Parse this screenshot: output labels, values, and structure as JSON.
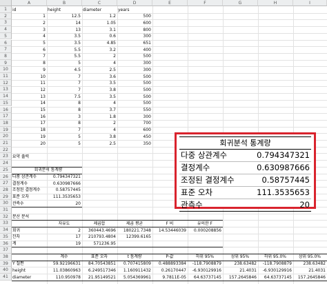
{
  "columns": [
    "A",
    "B",
    "C",
    "D",
    "E",
    "F",
    "G",
    "H",
    "I"
  ],
  "rows": [
    "1",
    "2",
    "3",
    "4",
    "5",
    "6",
    "7",
    "8",
    "9",
    "10",
    "11",
    "12",
    "13",
    "14",
    "15",
    "16",
    "17",
    "18",
    "19",
    "20",
    "21",
    "22",
    "23",
    "24",
    "25",
    "26",
    "27",
    "28",
    "29",
    "30",
    "31",
    "32",
    "33",
    "34",
    "35",
    "36",
    "37",
    "38",
    "39",
    "40",
    "41"
  ],
  "data_headers": [
    "id",
    "height",
    "diameter",
    "years"
  ],
  "data_rows": [
    [
      "1",
      "12.5",
      "1.2",
      "500"
    ],
    [
      "2",
      "14",
      "1.05",
      "600"
    ],
    [
      "3",
      "13",
      "3.1",
      "800"
    ],
    [
      "4",
      "3.5",
      "0.6",
      "300"
    ],
    [
      "5",
      "3.5",
      "4.85",
      "651"
    ],
    [
      "6",
      "5.5",
      "3.2",
      "400"
    ],
    [
      "7",
      "5.5",
      "2",
      "500"
    ],
    [
      "8",
      "5",
      "4",
      "300"
    ],
    [
      "9",
      "4.5",
      "2.5",
      "300"
    ],
    [
      "10",
      "7",
      "3.6",
      "500"
    ],
    [
      "11",
      "7",
      "3.5",
      "500"
    ],
    [
      "12",
      "7",
      "3.8",
      "500"
    ],
    [
      "13",
      "7.5",
      "3.5",
      "500"
    ],
    [
      "14",
      "8",
      "4",
      "500"
    ],
    [
      "15",
      "8",
      "3.7",
      "550"
    ],
    [
      "16",
      "3",
      "1.8",
      "300"
    ],
    [
      "17",
      "8",
      "2",
      "700"
    ],
    [
      "18",
      "7",
      "4",
      "600"
    ],
    [
      "19",
      "5",
      "3.8",
      "450"
    ],
    [
      "20",
      "5",
      "2.5",
      "350"
    ]
  ],
  "summary_title": "요약 출력",
  "regression_stats": {
    "header": "회귀분석 통계량",
    "rows": [
      {
        "label": "다중 상관계수",
        "value": "0.794347321"
      },
      {
        "label": "결정계수",
        "value": "0.630987666"
      },
      {
        "label": "조정된 결정계수",
        "value": "0.58757445"
      },
      {
        "label": "표준 오차",
        "value": "111.3535653"
      },
      {
        "label": "관측수",
        "value": "20"
      }
    ]
  },
  "anova": {
    "title": "분산 분석",
    "headers": [
      "",
      "자유도",
      "제곱합",
      "제곱 평균",
      "F 비",
      "유의한 F"
    ],
    "rows": [
      [
        "회귀",
        "2",
        "360443.4696",
        "180221.7348",
        "14.53446039",
        "0.000208856"
      ],
      [
        "잔차",
        "17",
        "210793.4804",
        "12399.6165",
        "",
        ""
      ],
      [
        "계",
        "19",
        "571236.95",
        "",
        "",
        ""
      ]
    ]
  },
  "coef": {
    "headers": [
      "",
      "계수",
      "표준 오차",
      "t 통계량",
      "P-값",
      "하위 95%",
      "상위 95%",
      "하위 95.0%",
      "상위 95.0%"
    ],
    "rows": [
      [
        "Y 절편",
        "59.92196631",
        "84.70543851",
        "0.707415809",
        "0.488893384",
        "-118.7908879",
        "238.63482",
        "-118.7908879",
        "238.63482"
      ],
      [
        "height",
        "11.03860963",
        "6.249517346",
        "1.160911432",
        "0.26170447",
        "-6.930129916",
        "21.4031",
        "-6.930129916",
        "21.4031"
      ],
      [
        "diameter",
        "110.950978",
        "21.95149521",
        "5.054369961",
        "9.7811E-05",
        "64.63737145",
        "157.2645846",
        "64.63737145",
        "157.2645846"
      ]
    ]
  }
}
